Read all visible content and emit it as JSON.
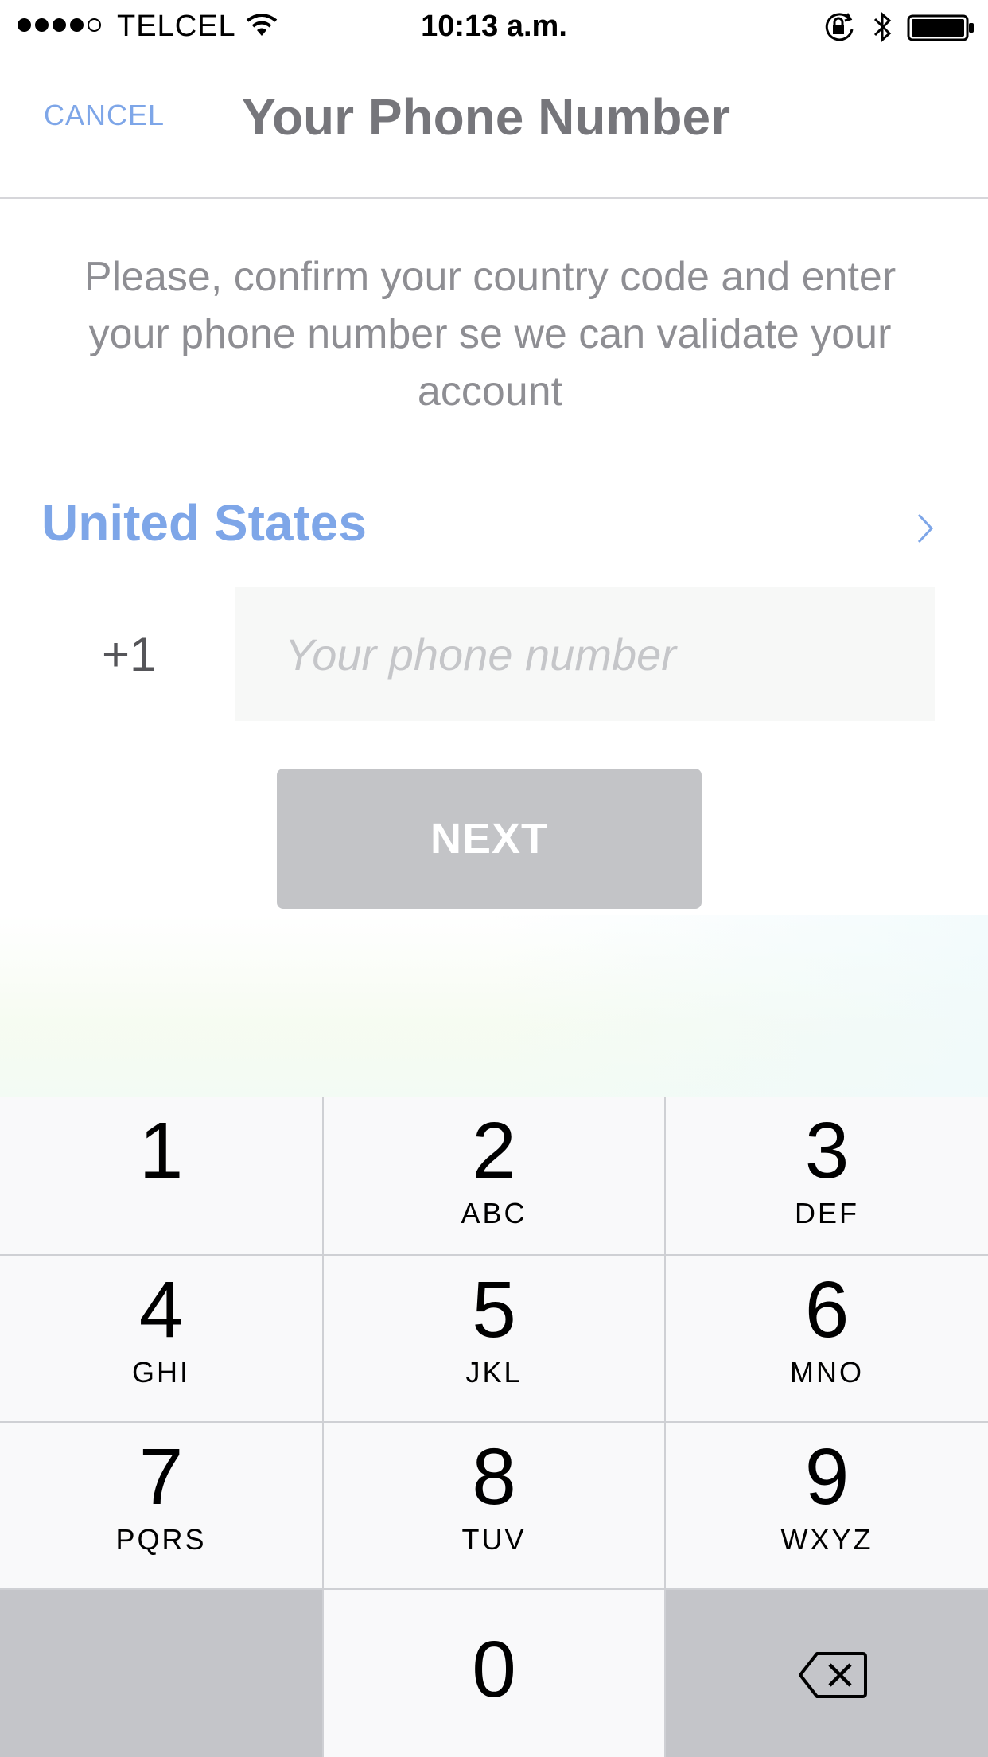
{
  "status_bar": {
    "carrier": "TELCEL",
    "time": "10:13 a.m.",
    "signal_bars_filled": 4,
    "signal_bars_total": 5,
    "battery_level": 1.0
  },
  "nav": {
    "cancel_label": "CANCEL",
    "title": "Your Phone Number"
  },
  "instructions": "Please, confirm your country code and enter your phone number se we can validate your account",
  "country": {
    "name": "United States",
    "dial_code": "+1"
  },
  "phone": {
    "value": "",
    "placeholder": "Your phone number"
  },
  "next_label": "NEXT",
  "keypad": {
    "keys": [
      {
        "num": "1",
        "letters": ""
      },
      {
        "num": "2",
        "letters": "ABC"
      },
      {
        "num": "3",
        "letters": "DEF"
      },
      {
        "num": "4",
        "letters": "GHI"
      },
      {
        "num": "5",
        "letters": "JKL"
      },
      {
        "num": "6",
        "letters": "MNO"
      },
      {
        "num": "7",
        "letters": "PQRS"
      },
      {
        "num": "8",
        "letters": "TUV"
      },
      {
        "num": "9",
        "letters": "WXYZ"
      },
      {
        "num": "0",
        "letters": ""
      }
    ]
  },
  "colors": {
    "accent": "#7ea6e8",
    "button_disabled": "#c3c4c7",
    "keypad_bg": "#cfd0d4"
  }
}
